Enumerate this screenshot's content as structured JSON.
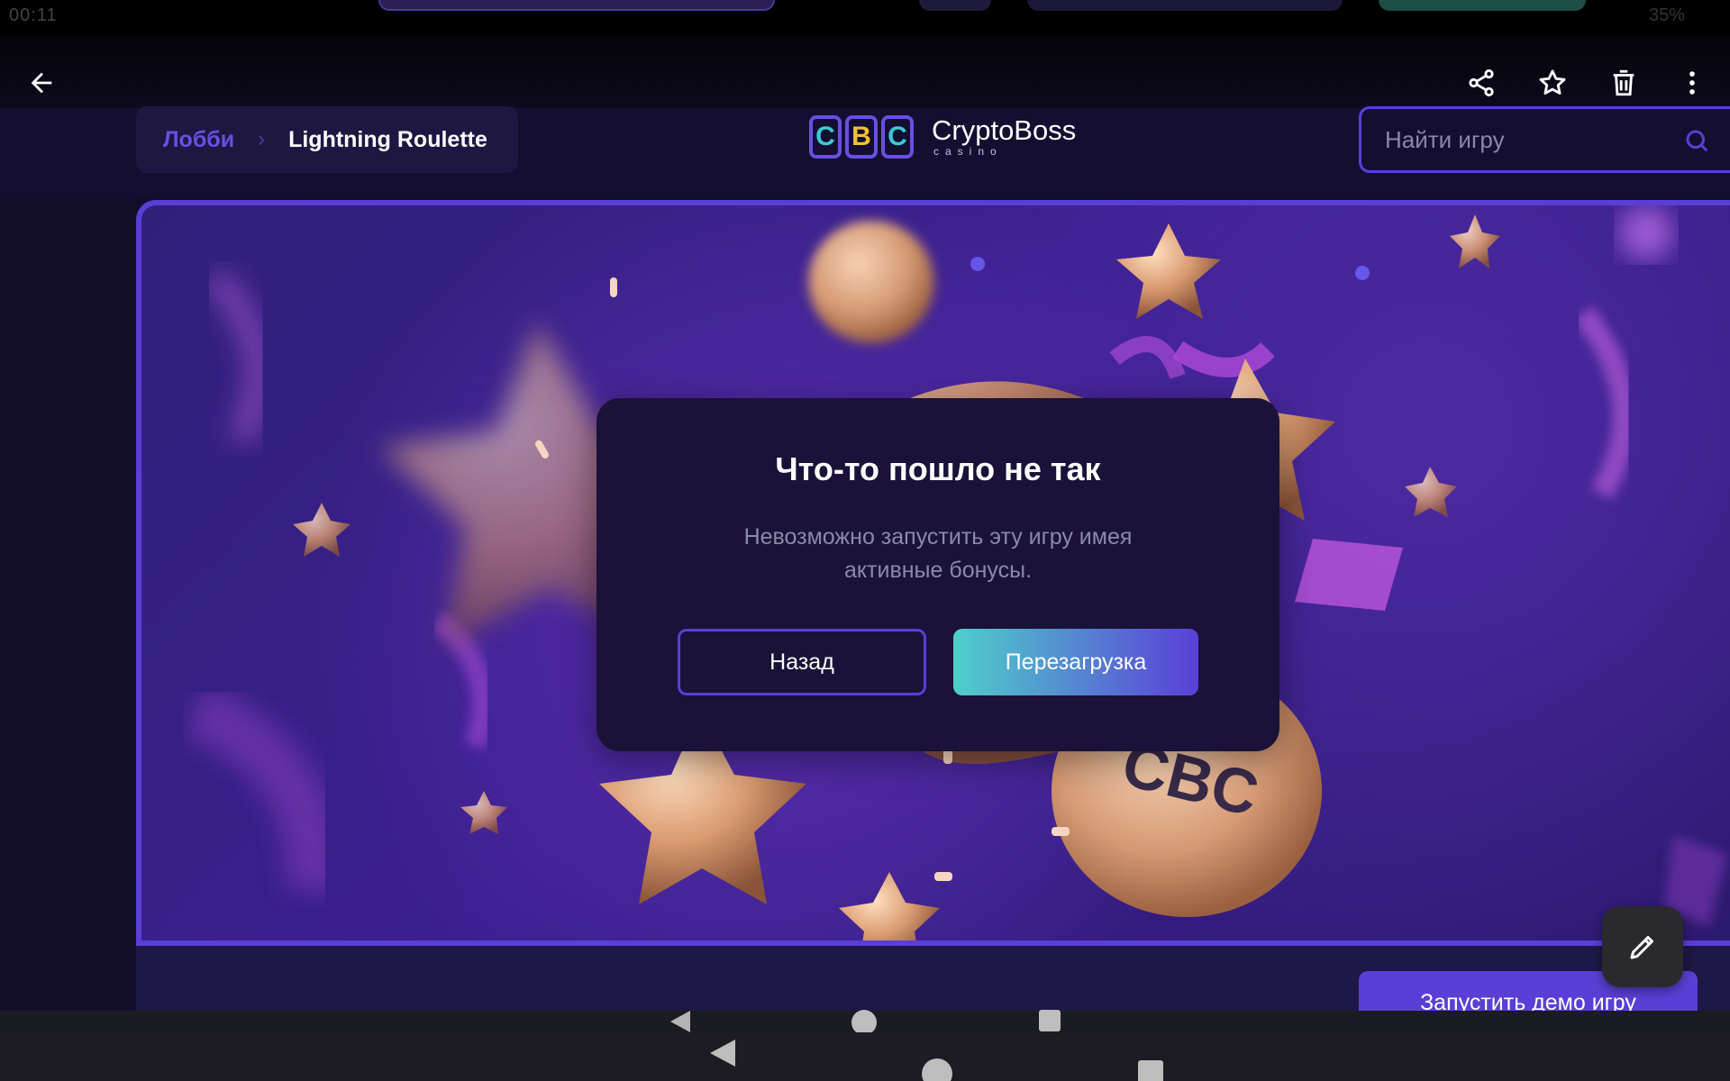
{
  "status_bar": {
    "time": "00:11",
    "right": "35%"
  },
  "app_bar": {
    "icons": [
      "back-arrow-icon",
      "share-icon",
      "star-icon",
      "trash-icon",
      "more-vert-icon"
    ]
  },
  "breadcrumb": {
    "lobby": "Лобби",
    "separator": "›",
    "current": "Lightning Roulette"
  },
  "logo": {
    "chips": [
      "C",
      "B",
      "C"
    ],
    "name": "CryptoBoss",
    "sub": "casino"
  },
  "search": {
    "placeholder": "Найти игру"
  },
  "modal": {
    "title": "Что-то пошло не так",
    "message": "Невозможно запустить эту игру имея активные бонусы.",
    "back_label": "Назад",
    "reload_label": "Перезагрузка"
  },
  "demo_button": {
    "label": "Запустить демо игру"
  },
  "colors": {
    "accent": "#5a3fd6",
    "background": "#140f31",
    "modal": "#1a1238",
    "teal": "#4fcfcb",
    "gold": "#f3c230"
  }
}
